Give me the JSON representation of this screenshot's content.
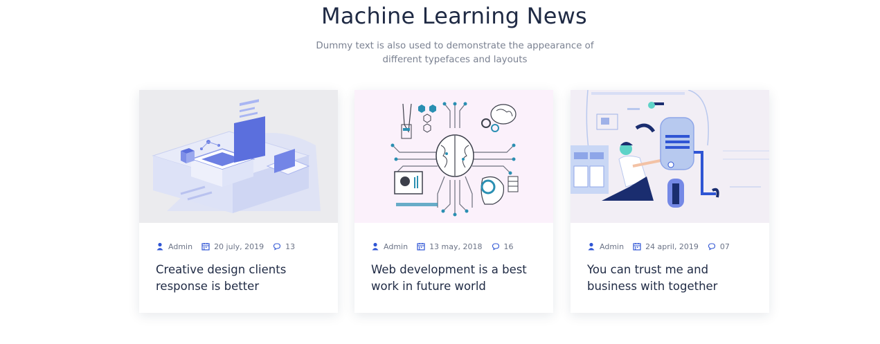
{
  "section": {
    "title": "Machine Learning News",
    "subtitle": "Dummy text is also used to demonstrate the appearance of different typefaces and layouts"
  },
  "colors": {
    "heading": "#1f2a44",
    "muted": "#7a8191",
    "accent": "#2f55d4",
    "card_bg": "#ffffff"
  },
  "posts": [
    {
      "image_icon": "isometric-tech-illustration",
      "author": "Admin",
      "date": "20 july, 2019",
      "comments": "13",
      "title": "Creative design clients response is better"
    },
    {
      "image_icon": "brain-network-illustration",
      "author": "Admin",
      "date": "13 may, 2018",
      "comments": "16",
      "title": "Web development is a best work in future world"
    },
    {
      "image_icon": "robot-scientist-illustration",
      "author": "Admin",
      "date": "24 april, 2019",
      "comments": "07",
      "title": "You can trust me and business with together"
    }
  ]
}
